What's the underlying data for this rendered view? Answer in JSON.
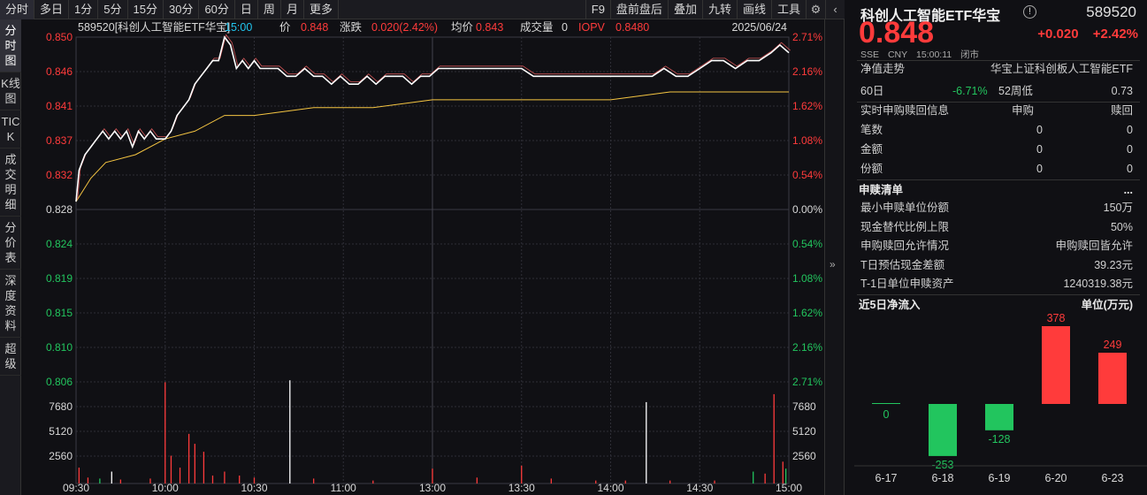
{
  "toolbar": {
    "left": [
      "分时",
      "多日",
      "1分",
      "5分",
      "15分",
      "30分",
      "60分",
      "日",
      "周",
      "月",
      "更多"
    ],
    "right": [
      "F9",
      "盘前盘后",
      "叠加",
      "九转",
      "画线",
      "工具"
    ]
  },
  "left_tabs": [
    "分时图",
    "K线图",
    "TICK",
    "成交明细",
    "分价表",
    "深度资料",
    "超级"
  ],
  "chart_header": {
    "name": "589520[科创人工智能ETF华宝]",
    "time": "15:00",
    "price_label": "价",
    "price": "0.848",
    "change_label": "涨跌",
    "change": "0.020(2.42%)",
    "avg_label": "均价",
    "avg": "0.843",
    "vol_label": "成交量",
    "vol": "0",
    "iopv_label": "IOPV",
    "iopv": "0.8480",
    "date": "2025/06/24"
  },
  "chart_data": {
    "type": "line",
    "price_ticks_up": [
      "0.850",
      "0.846",
      "0.841",
      "0.837",
      "0.832"
    ],
    "price_tick_base": "0.828",
    "price_ticks_down": [
      "0.824",
      "0.819",
      "0.815",
      "0.810",
      "0.806"
    ],
    "pct_ticks_up": [
      "2.71%",
      "2.16%",
      "1.62%",
      "1.08%",
      "0.54%"
    ],
    "pct_tick_base": "0.00%",
    "pct_ticks_down": [
      "0.54%",
      "1.08%",
      "1.62%",
      "2.16%",
      "2.71%"
    ],
    "vol_ticks": [
      "7680",
      "5120",
      "2560"
    ],
    "x_ticks": [
      "09:30",
      "10:00",
      "10:30",
      "11:00",
      "13:00",
      "13:30",
      "14:00",
      "14:30",
      "15:00"
    ],
    "ylim": [
      0.806,
      0.85
    ],
    "base_price": 0.828,
    "price_series": [
      [
        0,
        0.829
      ],
      [
        1,
        0.833
      ],
      [
        2,
        0.834
      ],
      [
        3,
        0.835
      ],
      [
        5,
        0.836
      ],
      [
        7,
        0.837
      ],
      [
        9,
        0.838
      ],
      [
        11,
        0.837
      ],
      [
        13,
        0.838
      ],
      [
        15,
        0.837
      ],
      [
        17,
        0.838
      ],
      [
        19,
        0.836
      ],
      [
        21,
        0.838
      ],
      [
        23,
        0.837
      ],
      [
        25,
        0.838
      ],
      [
        27,
        0.837
      ],
      [
        30,
        0.837
      ],
      [
        32,
        0.838
      ],
      [
        34,
        0.84
      ],
      [
        36,
        0.841
      ],
      [
        38,
        0.842
      ],
      [
        40,
        0.844
      ],
      [
        42,
        0.845
      ],
      [
        44,
        0.846
      ],
      [
        46,
        0.847
      ],
      [
        48,
        0.847
      ],
      [
        50,
        0.85
      ],
      [
        52,
        0.849
      ],
      [
        54,
        0.846
      ],
      [
        56,
        0.847
      ],
      [
        58,
        0.846
      ],
      [
        60,
        0.847
      ],
      [
        62,
        0.846
      ],
      [
        65,
        0.846
      ],
      [
        68,
        0.846
      ],
      [
        71,
        0.845
      ],
      [
        74,
        0.845
      ],
      [
        77,
        0.846
      ],
      [
        80,
        0.845
      ],
      [
        83,
        0.845
      ],
      [
        86,
        0.844
      ],
      [
        89,
        0.845
      ],
      [
        92,
        0.844
      ],
      [
        95,
        0.844
      ],
      [
        98,
        0.845
      ],
      [
        101,
        0.844
      ],
      [
        104,
        0.845
      ],
      [
        107,
        0.845
      ],
      [
        110,
        0.845
      ],
      [
        113,
        0.844
      ],
      [
        116,
        0.845
      ],
      [
        119,
        0.845
      ],
      [
        122,
        0.846
      ],
      [
        125,
        0.846
      ],
      [
        128,
        0.846
      ],
      [
        131,
        0.846
      ],
      [
        134,
        0.846
      ],
      [
        137,
        0.846
      ],
      [
        140,
        0.846
      ],
      [
        143,
        0.846
      ],
      [
        146,
        0.846
      ],
      [
        150,
        0.846
      ],
      [
        154,
        0.845
      ],
      [
        158,
        0.845
      ],
      [
        162,
        0.845
      ],
      [
        166,
        0.845
      ],
      [
        170,
        0.845
      ],
      [
        174,
        0.845
      ],
      [
        178,
        0.845
      ],
      [
        182,
        0.845
      ],
      [
        186,
        0.845
      ],
      [
        190,
        0.845
      ],
      [
        194,
        0.845
      ],
      [
        198,
        0.846
      ],
      [
        202,
        0.845
      ],
      [
        206,
        0.845
      ],
      [
        210,
        0.846
      ],
      [
        214,
        0.847
      ],
      [
        218,
        0.847
      ],
      [
        222,
        0.846
      ],
      [
        226,
        0.847
      ],
      [
        230,
        0.847
      ],
      [
        234,
        0.848
      ],
      [
        237,
        0.849
      ],
      [
        240,
        0.848
      ]
    ],
    "avg_series": [
      [
        0,
        0.829
      ],
      [
        5,
        0.832
      ],
      [
        10,
        0.834
      ],
      [
        20,
        0.835
      ],
      [
        30,
        0.837
      ],
      [
        40,
        0.838
      ],
      [
        50,
        0.84
      ],
      [
        60,
        0.84
      ],
      [
        80,
        0.841
      ],
      [
        100,
        0.841
      ],
      [
        120,
        0.842
      ],
      [
        140,
        0.842
      ],
      [
        160,
        0.842
      ],
      [
        180,
        0.842
      ],
      [
        200,
        0.843
      ],
      [
        220,
        0.843
      ],
      [
        240,
        0.843
      ]
    ],
    "volume_bars": [
      {
        "t": 1,
        "v": 1600,
        "c": "red"
      },
      {
        "t": 4,
        "v": 600,
        "c": "red"
      },
      {
        "t": 8,
        "v": 500,
        "c": "green"
      },
      {
        "t": 12,
        "v": 1200,
        "c": "white"
      },
      {
        "t": 15,
        "v": 400,
        "c": "red"
      },
      {
        "t": 25,
        "v": 500,
        "c": "red"
      },
      {
        "t": 30,
        "v": 10200,
        "c": "red"
      },
      {
        "t": 32,
        "v": 2800,
        "c": "red"
      },
      {
        "t": 35,
        "v": 1600,
        "c": "red"
      },
      {
        "t": 38,
        "v": 5000,
        "c": "red"
      },
      {
        "t": 40,
        "v": 4000,
        "c": "red"
      },
      {
        "t": 43,
        "v": 3200,
        "c": "red"
      },
      {
        "t": 46,
        "v": 800,
        "c": "red"
      },
      {
        "t": 50,
        "v": 1200,
        "c": "red"
      },
      {
        "t": 55,
        "v": 800,
        "c": "red"
      },
      {
        "t": 60,
        "v": 600,
        "c": "red"
      },
      {
        "t": 72,
        "v": 10400,
        "c": "white"
      },
      {
        "t": 80,
        "v": 500,
        "c": "red"
      },
      {
        "t": 100,
        "v": 300,
        "c": "red"
      },
      {
        "t": 120,
        "v": 1500,
        "c": "red"
      },
      {
        "t": 135,
        "v": 600,
        "c": "red"
      },
      {
        "t": 150,
        "v": 1800,
        "c": "red"
      },
      {
        "t": 160,
        "v": 500,
        "c": "red"
      },
      {
        "t": 175,
        "v": 300,
        "c": "red"
      },
      {
        "t": 185,
        "v": 300,
        "c": "red"
      },
      {
        "t": 192,
        "v": 8200,
        "c": "white"
      },
      {
        "t": 200,
        "v": 300,
        "c": "red"
      },
      {
        "t": 215,
        "v": 300,
        "c": "red"
      },
      {
        "t": 228,
        "v": 1200,
        "c": "green"
      },
      {
        "t": 232,
        "v": 1000,
        "c": "red"
      },
      {
        "t": 235,
        "v": 9000,
        "c": "red"
      },
      {
        "t": 238,
        "v": 2200,
        "c": "red"
      },
      {
        "t": 239,
        "v": 1500,
        "c": "green"
      }
    ]
  },
  "quote": {
    "name": "科创人工智能ETF华宝",
    "code": "589520",
    "price": "0.848",
    "change": "+0.020",
    "change_pct": "+2.42%",
    "meta": [
      "SSE",
      "CNY",
      "15:00:11",
      "闭市"
    ]
  },
  "nav": {
    "label": "净值走势",
    "index": "华宝上证科创板人工智能ETF"
  },
  "period_row": {
    "label": "60日",
    "pct": "-6.71%",
    "mid": "52周低",
    "val": "0.73"
  },
  "realtime": {
    "title": "实时申购赎回信息",
    "col1": "申购",
    "col2": "赎回",
    "rows": [
      {
        "label": "笔数",
        "a": "0",
        "b": "0"
      },
      {
        "label": "金额",
        "a": "0",
        "b": "0"
      },
      {
        "label": "份额",
        "a": "0",
        "b": "0"
      }
    ]
  },
  "redeem_list": {
    "title": "申赎清单",
    "more": "...",
    "rows": [
      {
        "label": "最小申赎单位份额",
        "val": "150万"
      },
      {
        "label": "现金替代比例上限",
        "val": "50%"
      },
      {
        "label": "申购赎回允许情况",
        "val": "申购赎回皆允许"
      },
      {
        "label": "T日预估现金差额",
        "val": "39.23元"
      },
      {
        "label": "T-1日单位申赎资产",
        "val": "1240319.38元"
      }
    ]
  },
  "net_flow": {
    "title": "近5日净流入",
    "unit": "单位(万元)",
    "bars": [
      {
        "date": "6-17",
        "value": 0
      },
      {
        "date": "6-18",
        "value": -253
      },
      {
        "date": "6-19",
        "value": -128
      },
      {
        "date": "6-20",
        "value": 378
      },
      {
        "date": "6-23",
        "value": 249
      }
    ]
  },
  "colors": {
    "up": "#ff3b3b",
    "down": "#22c55e",
    "price_line": "#ffffff",
    "avg_line": "#f5c542",
    "grid": "#2e2e36"
  }
}
